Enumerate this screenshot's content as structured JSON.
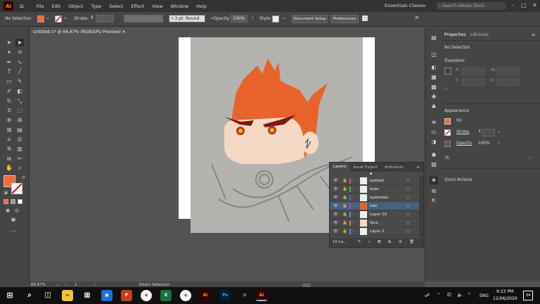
{
  "menubar": {
    "logo": "Ai",
    "items": [
      "File",
      "Edit",
      "Object",
      "Type",
      "Select",
      "Effect",
      "View",
      "Window",
      "Help"
    ],
    "workspace": "Essentials Classic",
    "search_placeholder": "Search Adobe Stock"
  },
  "control": {
    "selection": "No Selection",
    "stroke_label": "Stroke:",
    "stroke_profile": "3 pt. Round",
    "opacity_label": "Opacity:",
    "opacity": "100%",
    "style_label": "Style:",
    "doc_setup": "Document Setup",
    "preferences": "Preferences"
  },
  "document": {
    "tab_title": "Untitled-1* @ 66.67% (RGB/GPU Preview)",
    "zoom": "66.67%",
    "artboard": "1",
    "tool": "Direct Selection"
  },
  "layers": {
    "tabs": [
      "Layers",
      "Asset Export",
      "Artboards"
    ],
    "rows": [
      {
        "name": "eyeball",
        "color": "#e0409a"
      },
      {
        "name": "eyes",
        "color": "#3fbf3f"
      },
      {
        "name": "eyebrows",
        "color": "#3f6fdf"
      },
      {
        "name": "hair",
        "color": "#c040c0",
        "selected": true
      },
      {
        "name": "Layer 10",
        "color": "#5a8fdf"
      },
      {
        "name": "face",
        "color": "#e07a30"
      },
      {
        "name": "Layer 1",
        "color": "#5a8fdf"
      }
    ],
    "count": "10 La..."
  },
  "properties": {
    "tabs": [
      "Properties",
      "Libraries"
    ],
    "selection": "No Selection",
    "transform": "Transform",
    "x_label": "X:",
    "y_label": "Y:",
    "w_label": "W:",
    "h_label": "H:",
    "appearance": "Appearance",
    "fill": "Fill",
    "stroke": "Stroke",
    "opacity": "Opacity",
    "opacity_value": "100%",
    "fx": "fx.",
    "quick_actions": "Quick Actions"
  },
  "taskbar": {
    "time": "9:23 PM",
    "date": "12/06/2020",
    "lang": "ENG",
    "notifications": "34"
  },
  "colors": {
    "fill": "#f26b3a",
    "hair": "#e8632c",
    "brow": "#7a1b0e",
    "skin": "#f3d9c4"
  }
}
